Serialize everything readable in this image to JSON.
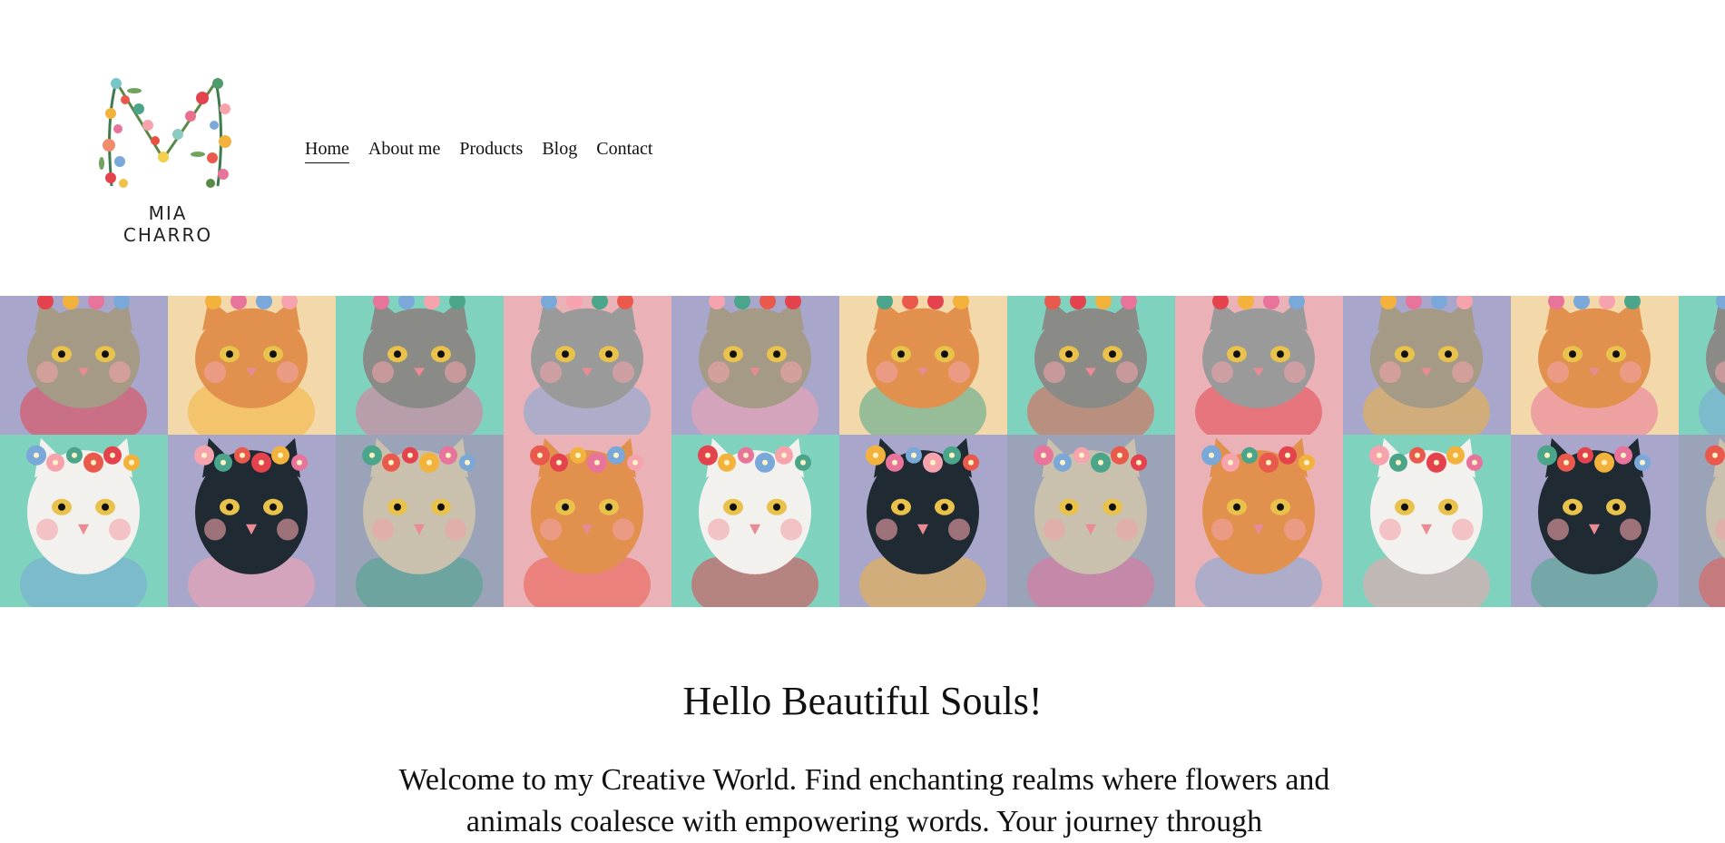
{
  "brand": {
    "name": "MIA CHARRO",
    "logo_letter": "M"
  },
  "nav": {
    "items": [
      {
        "label": "Home",
        "active": true
      },
      {
        "label": "About me",
        "active": false
      },
      {
        "label": "Products",
        "active": false
      },
      {
        "label": "Blog",
        "active": false
      },
      {
        "label": "Contact",
        "active": false
      }
    ]
  },
  "banner": {
    "subject": "floral cat portraits",
    "palette": {
      "lavender": "#a9a6cc",
      "peach": "#f3d9a9",
      "mint": "#7fd2bd",
      "pink": "#eab2b6",
      "grey_cat": "#8a8a86",
      "orange_cat": "#e2904d",
      "black_cat": "#1f2a33"
    }
  },
  "main": {
    "heading": "Hello Beautiful Souls!",
    "intro": "Welcome to my Creative World. Find enchanting realms where flowers and animals coalesce with empowering words. Your journey through"
  }
}
